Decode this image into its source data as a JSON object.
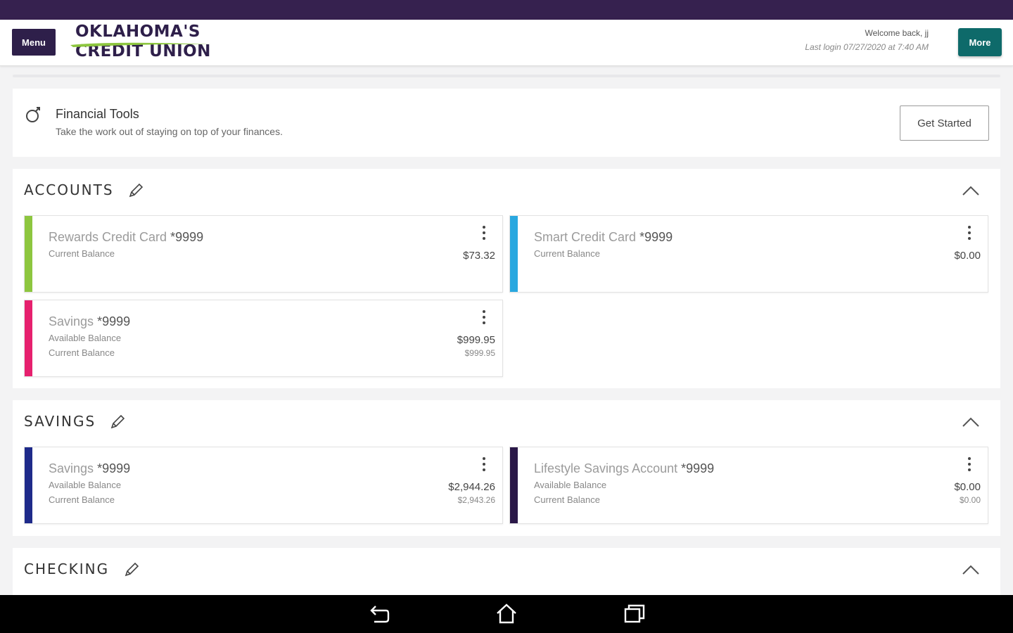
{
  "header": {
    "menu_label": "Menu",
    "logo_line1": "OKLAHOMA'S",
    "logo_line2": "CREDIT UNION",
    "welcome": "Welcome back, jj",
    "last_login": "Last login 07/27/2020 at 7:40 AM",
    "more_label": "More"
  },
  "tools": {
    "title": "Financial Tools",
    "subtitle": "Take the work out of staying on top of your finances.",
    "button": "Get Started"
  },
  "sections": {
    "accounts": {
      "title": "ACCOUNTS",
      "cards": [
        {
          "name": "Rewards Credit Card",
          "number": "*9999",
          "label1": "Current Balance",
          "amount1": "$73.32",
          "color": "#8dc63f"
        },
        {
          "name": "Smart Credit Card",
          "number": "*9999",
          "label1": "Current Balance",
          "amount1": "$0.00",
          "color": "#29a8e0"
        },
        {
          "name": "Savings",
          "number": "*9999",
          "label1": "Available Balance",
          "label2": "Current Balance",
          "amount1": "$999.95",
          "amount2": "$999.95",
          "color": "#e6206e"
        }
      ]
    },
    "savings": {
      "title": "SAVINGS",
      "cards": [
        {
          "name": "Savings",
          "number": "*9999",
          "label1": "Available Balance",
          "label2": "Current Balance",
          "amount1": "$2,944.26",
          "amount2": "$2,943.26",
          "color": "#1e2a8a"
        },
        {
          "name": "Lifestyle Savings Account",
          "number": "*9999",
          "label1": "Available Balance",
          "label2": "Current Balance",
          "amount1": "$0.00",
          "amount2": "$0.00",
          "color": "#2a1848"
        }
      ]
    },
    "checking": {
      "title": "CHECKING"
    }
  },
  "colors": {
    "brand_purple": "#36214f",
    "more_teal": "#0e6a6a",
    "logo_green": "#8dc63f"
  },
  "icons": [
    "menu",
    "logo-swoosh",
    "more",
    "financial-tools-icon",
    "pencil-icon",
    "chevron-up-icon",
    "kebab-icon",
    "back-icon",
    "home-icon",
    "recents-icon"
  ]
}
